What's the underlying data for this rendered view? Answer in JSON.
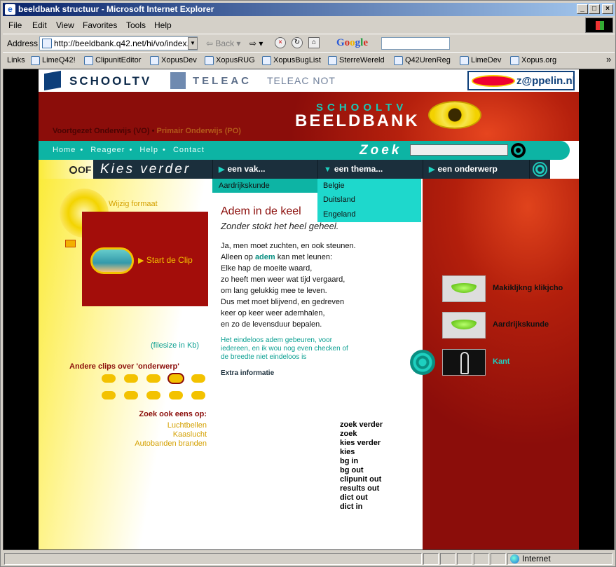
{
  "window": {
    "title": "beeldbank structuur - Microsoft Internet Explorer"
  },
  "menu": [
    "File",
    "Edit",
    "View",
    "Favorites",
    "Tools",
    "Help"
  ],
  "address": {
    "label": "Address",
    "url": "http://beeldbank.q42.net/hi/vo/index.j",
    "back": "Back",
    "google": "Google"
  },
  "links": {
    "label": "Links",
    "items": [
      "LimeQ42!",
      "ClipunitEditor",
      "XopusDev",
      "XopusRUG",
      "XopusBugList",
      "SterreWereld",
      "Q42UrenReg",
      "LimeDev",
      "Xopus.org"
    ]
  },
  "status": {
    "zone": "Internet"
  },
  "logos": {
    "schooltv": "SCHOOLTV",
    "teleac": "TELEAC",
    "teleacnot": "TELEAC NOT",
    "zeppelin": "z@ppelin.nl"
  },
  "header": {
    "brand_top": "SCHOOLTV",
    "brand_bottom": "BEELDBANK",
    "vo": "Voortgezet Onderwijs (VO)",
    "sep": "•",
    "po": "Primair Onderwijs (PO)"
  },
  "nav": {
    "items": [
      "Home",
      "Reageer",
      "Help",
      "Contact"
    ],
    "search_label": "Zoek"
  },
  "kies": {
    "of": "OF",
    "label": "Kies verder",
    "vak": "een vak...",
    "thema": "een thema...",
    "onderwerp": "een onderwerp"
  },
  "dropdowns": {
    "vak_selected": "Aardrijkskunde",
    "thema_options": [
      "Belgie",
      "Duitsland",
      "Engeland"
    ]
  },
  "left": {
    "wijzig": "Wijzig formaat",
    "start_clip": "Start de Clip",
    "filesize": "(filesize in Kb)",
    "andere": "Andere clips over 'onderwerp'",
    "zoek_ook": "Zoek ook eens op:",
    "suggestions": [
      "Luchtbellen",
      "Kaaslucht",
      "Autobanden branden"
    ]
  },
  "content": {
    "title": "Adem in de keel",
    "subtitle": "Zonder stokt het heel geheel.",
    "poem": [
      "Ja, men moet zuchten, en ook steunen.",
      "Alleen op ",
      "adem",
      " kan met leunen:",
      "Elke hap de moeite waard,",
      "zo heeft men weer wat tijd vergaard,",
      "om lang gelukkig mee te leven.",
      "Dus met moet blijvend, en gedreven",
      "keer op keer weer ademhalen,",
      "en zo de levensduur bepalen."
    ],
    "note": [
      "Het eindeloos adem gebeuren, voor",
      "iedereen, en ik wou nog even checken of",
      "de breedte niet eindeloos is"
    ],
    "extra": "Extra informatie",
    "debug": [
      "zoek verder",
      "zoek",
      "kies verder",
      "kies",
      "bg in",
      "bg out",
      "clipunit out",
      "results out",
      "dict out",
      "dict in"
    ]
  },
  "right": {
    "items": [
      "Makikljkng klikjcho",
      "Aardrijkskunde",
      "Kant"
    ]
  }
}
